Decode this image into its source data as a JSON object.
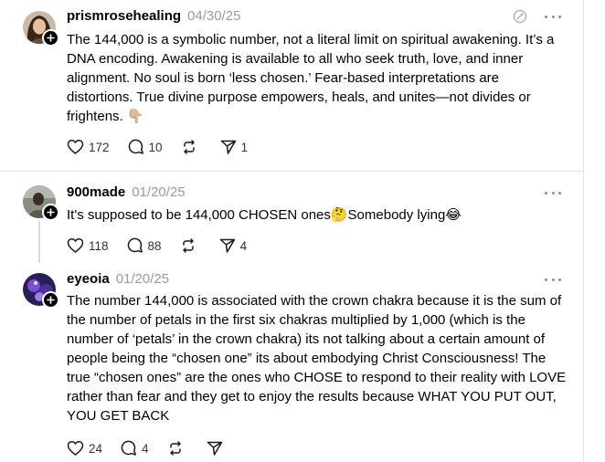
{
  "posts": [
    {
      "username": "prismrosehealing",
      "date": "04/30/25",
      "text": "The 144,000 is a symbolic number, not a literal limit on spiritual awakening. It’s a DNA encoding. Awakening is available to all who seek truth, love, and inner alignment. No soul is born ‘less chosen.’ Fear-based interpretations are distortions. True divine purpose empowers, heals, and unites—not divides or frightens. 👇🏼",
      "likes": "172",
      "replies": "10",
      "reposts": "",
      "shares": "1"
    },
    {
      "username": "900made",
      "date": "01/20/25",
      "text": "It's supposed to be 144,000 CHOSEN ones🤔Somebody lying😂",
      "likes": "118",
      "replies": "88",
      "reposts": "",
      "shares": "4"
    },
    {
      "username": "eyeoia",
      "date": "01/20/25",
      "text": "The number 144,000 is associated with the crown chakra because it is the sum of the number of petals in the first six chakras multiplied by 1,000 (which is the number of ‘petals’ in the crown chakra) its not talking about a certain amount of people being the “chosen one” its about embodying Christ Consciousness! The true “chosen ones” are the ones who CHOSE to respond to their reality with LOVE rather than fear and they get to enjoy the results because WHAT YOU PUT OUT, YOU GET BACK",
      "likes": "24",
      "replies": "4",
      "reposts": "",
      "shares": ""
    }
  ],
  "icons": {
    "like": "heart-icon",
    "reply": "comment-icon",
    "repost": "repost-icon",
    "share": "send-icon",
    "more": "more-icon",
    "follow": "plus-icon",
    "edit": "edit-icon"
  },
  "colors": {
    "text": "#000000",
    "muted": "#9a9a9a",
    "divider": "#e5e5e5",
    "icon": "#1a1a1a"
  }
}
